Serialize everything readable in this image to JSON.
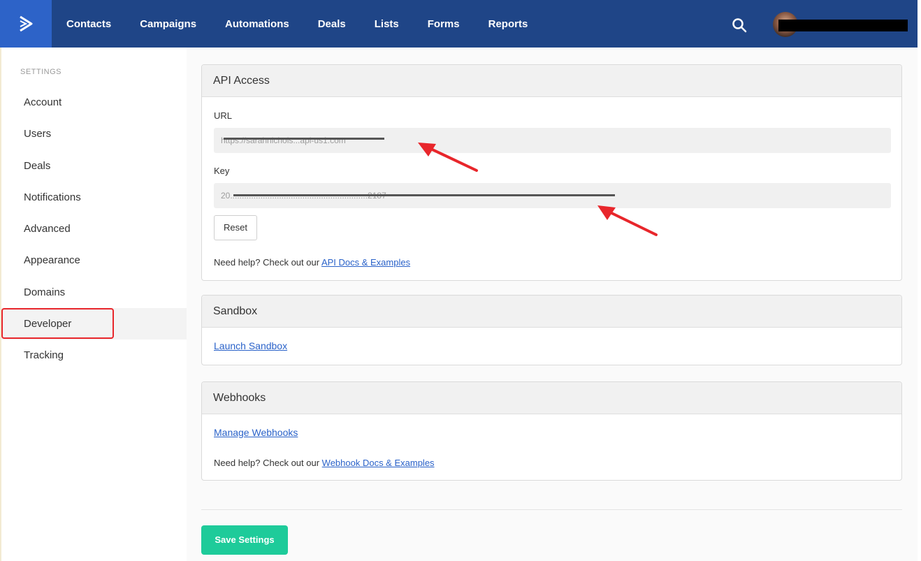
{
  "topbar": {
    "nav": [
      "Contacts",
      "Campaigns",
      "Automations",
      "Deals",
      "Lists",
      "Forms",
      "Reports"
    ]
  },
  "sidebar": {
    "heading": "SETTINGS",
    "items": [
      "Account",
      "Users",
      "Deals",
      "Notifications",
      "Advanced",
      "Appearance",
      "Domains",
      "Developer",
      "Tracking"
    ],
    "active": "Developer"
  },
  "api_access": {
    "title": "API Access",
    "url_label": "URL",
    "url_value": "https://sarahnichols...api-us1.com",
    "key_label": "Key",
    "key_value": "20...........................................................2187",
    "reset_label": "Reset",
    "help_text": "Need help? Check out our ",
    "help_link": "API Docs & Examples"
  },
  "sandbox": {
    "title": "Sandbox",
    "link": "Launch Sandbox"
  },
  "webhooks": {
    "title": "Webhooks",
    "link": "Manage Webhooks",
    "help_text": "Need help? Check out our ",
    "help_link": "Webhook Docs & Examples"
  },
  "save_label": "Save Settings",
  "colors": {
    "topbar": "#1f4587",
    "logo_bg": "#2d63c8",
    "save_button": "#1ecb9a",
    "link": "#2a62c9",
    "highlight": "#e8262b"
  }
}
